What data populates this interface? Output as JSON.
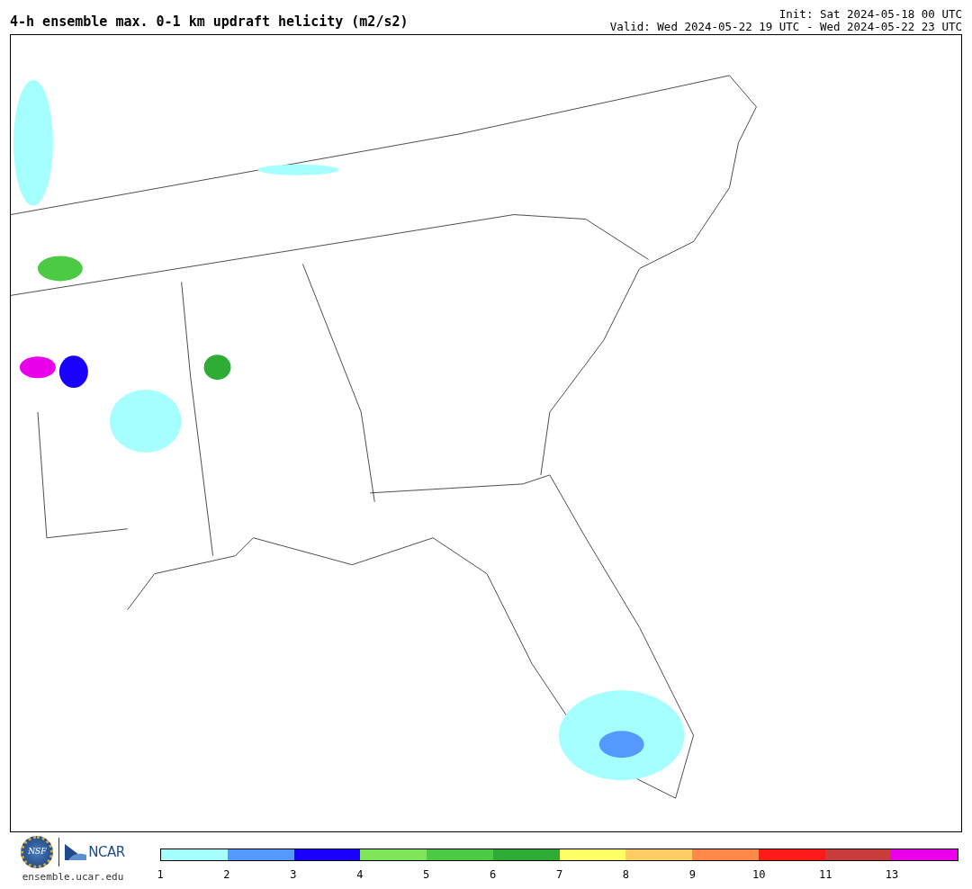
{
  "header": {
    "title": "4-h ensemble max. 0-1 km updraft helicity (m2/s2)",
    "init": "Init: Sat 2024-05-18 00 UTC",
    "valid": "Valid: Wed 2024-05-22 19 UTC - Wed 2024-05-22 23 UTC"
  },
  "footer": {
    "logo_left": "NSF",
    "logo_right": "NCAR",
    "site": "ensemble.ucar.edu"
  },
  "colorbar": [
    {
      "color": "#a6ffff",
      "label": "1"
    },
    {
      "color": "#5599ff",
      "label": "2"
    },
    {
      "color": "#1a00ff",
      "label": "3"
    },
    {
      "color": "#7fe55a",
      "label": "4"
    },
    {
      "color": "#4cca44",
      "label": "5"
    },
    {
      "color": "#2eac36",
      "label": "6"
    },
    {
      "color": "#ffff66",
      "label": "7"
    },
    {
      "color": "#ffcc66",
      "label": "8"
    },
    {
      "color": "#ff884a",
      "label": "9"
    },
    {
      "color": "#ff1a1a",
      "label": "10"
    },
    {
      "color": "#c83c3c",
      "label": "11"
    },
    {
      "color": "#ea00ea",
      "label": "13"
    }
  ]
}
